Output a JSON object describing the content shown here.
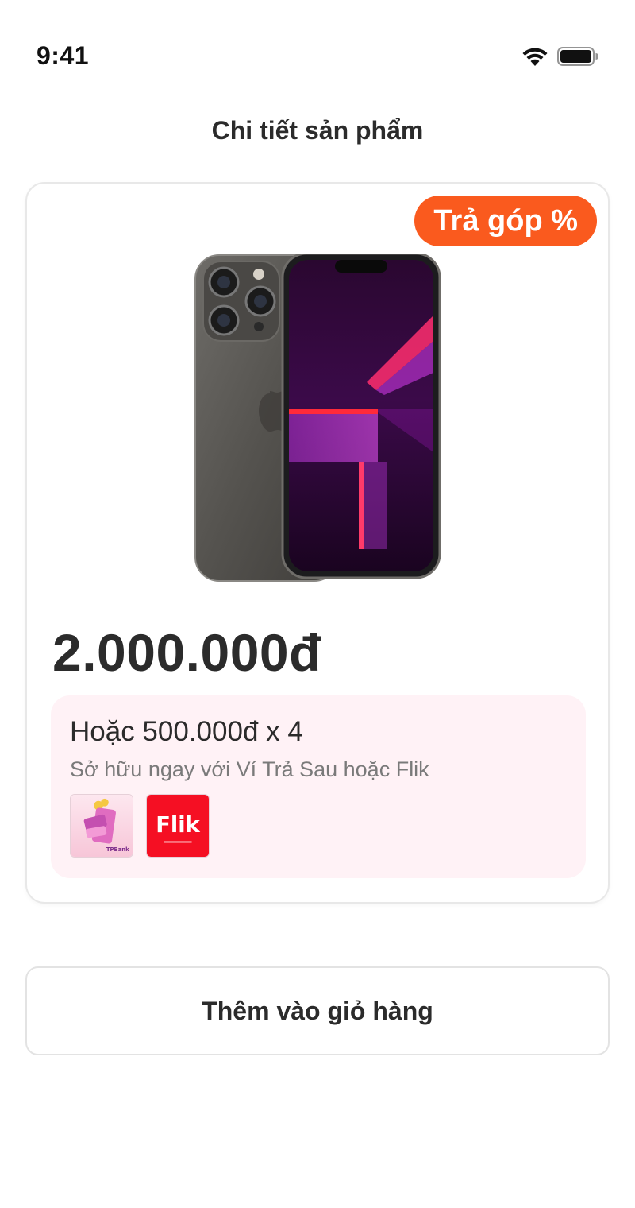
{
  "status_bar": {
    "time": "9:41",
    "icons": [
      "wifi-icon",
      "battery-icon"
    ]
  },
  "header": {
    "title": "Chi tiết sản phẩm"
  },
  "product": {
    "badge": "Trả góp %",
    "image": "iphone-product-image",
    "price": "2.000.000đ"
  },
  "installment": {
    "line": "Hoặc 500.000đ x 4",
    "subtext": "Sở hữu ngay với Ví Trả Sau hoặc Flik",
    "providers": [
      {
        "name": "tpbank-wallet-logo",
        "caption": "TPBank"
      },
      {
        "name": "flik-logo",
        "caption": "Flik"
      }
    ]
  },
  "actions": {
    "add_to_cart": "Thêm vào giỏ hàng"
  },
  "colors": {
    "accent": "#fa5a1e",
    "installment_bg": "#fff2f6",
    "text": "#2b2b2b",
    "muted": "#7a7a7a"
  }
}
